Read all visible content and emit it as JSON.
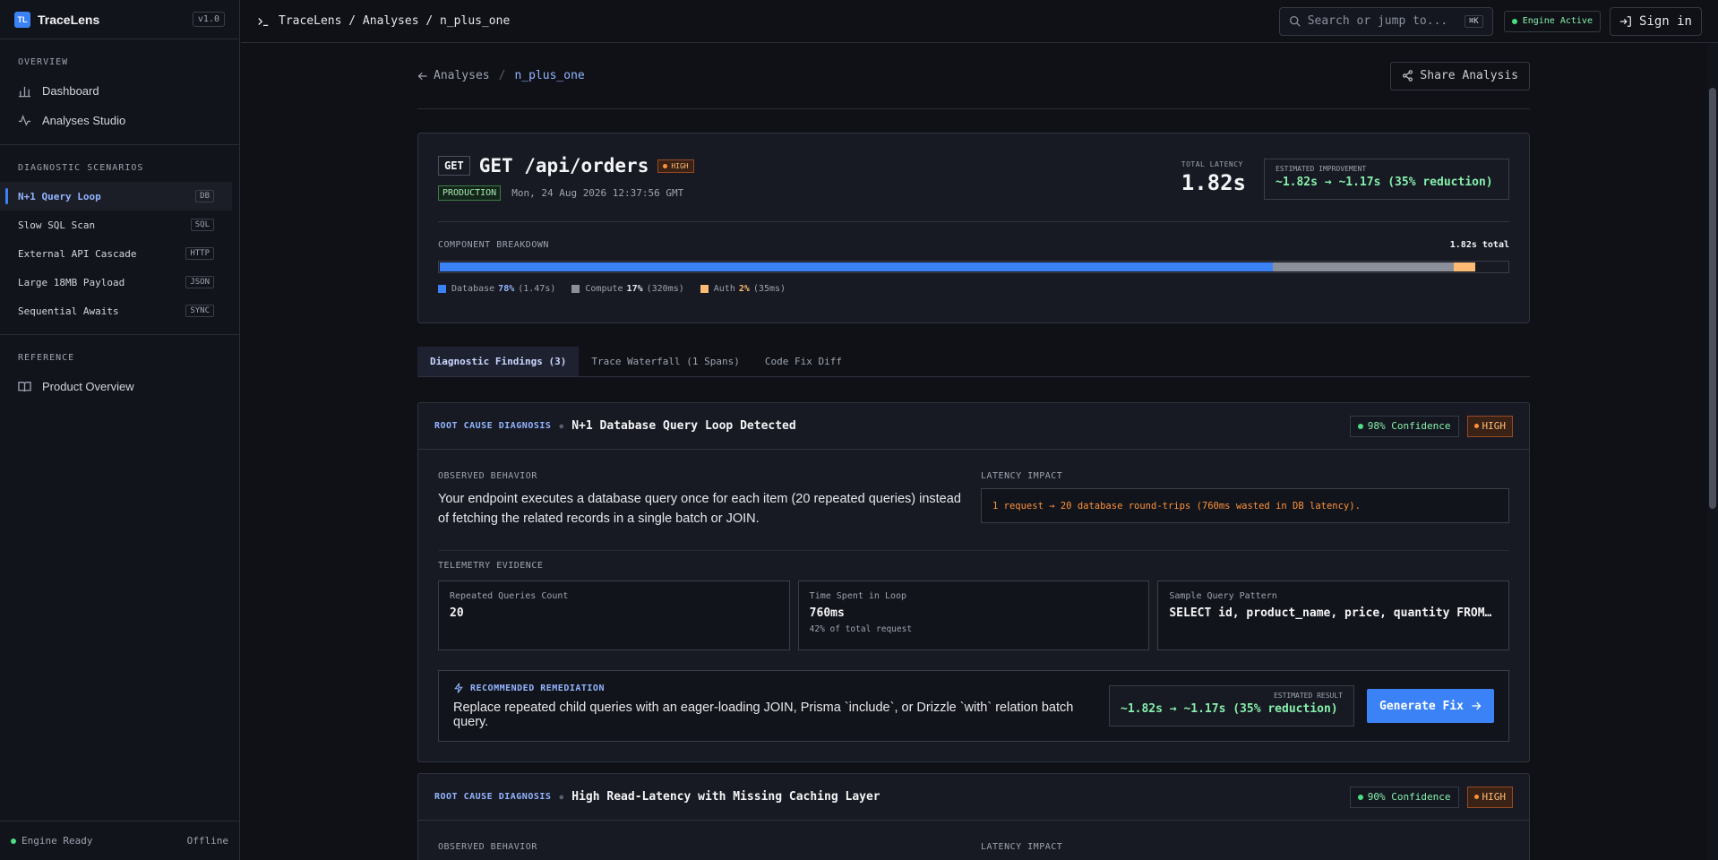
{
  "sidebar": {
    "brand_logo": "TL",
    "brand_name": "TraceLens",
    "version": "v1.0",
    "overview_header": "OVERVIEW",
    "overview_items": [
      {
        "label": "Dashboard",
        "icon": "bar-chart-icon"
      },
      {
        "label": "Analyses Studio",
        "icon": "activity-icon"
      }
    ],
    "scenarios_header": "DIAGNOSTIC SCENARIOS",
    "scenarios": [
      {
        "label": "N+1 Query Loop",
        "tag": "DB",
        "active": true
      },
      {
        "label": "Slow SQL Scan",
        "tag": "SQL"
      },
      {
        "label": "External API Cascade",
        "tag": "HTTP"
      },
      {
        "label": "Large 18MB Payload",
        "tag": "JSON"
      },
      {
        "label": "Sequential Awaits",
        "tag": "SYNC"
      }
    ],
    "reference_header": "REFERENCE",
    "reference_items": [
      {
        "label": "Product Overview",
        "icon": "book-icon"
      }
    ],
    "footer_status": "Engine Ready",
    "footer_mode": "Offline"
  },
  "topbar": {
    "breadcrumb": "TraceLens / Analyses / n_plus_one",
    "search_placeholder": "Search or jump to...",
    "search_shortcut": "⌘K",
    "engine_status": "Engine Active",
    "sign_in": "Sign in"
  },
  "page": {
    "back_label": "Analyses",
    "separator": "/",
    "current": "n_plus_one",
    "share_label": "Share Analysis"
  },
  "summary": {
    "method": "GET",
    "endpoint": "GET /api/orders",
    "severity": "HIGH",
    "environment": "PRODUCTION",
    "timestamp": "Mon, 24 Aug 2026 12:37:56 GMT",
    "latency_label": "TOTAL LATENCY",
    "latency_value": "1.82s",
    "improvement_label": "ESTIMATED IMPROVEMENT",
    "improvement_value": "~1.82s → ~1.17s (35% reduction)",
    "breakdown_label": "COMPONENT BREAKDOWN",
    "breakdown_total": "1.82s total",
    "components": [
      {
        "name": "Database",
        "pct": "78%",
        "time": "(1.47s)",
        "share": 78,
        "color": "#3b82f6"
      },
      {
        "name": "Compute",
        "pct": "17%",
        "time": "(320ms)",
        "share": 17,
        "color": "#8b8f99"
      },
      {
        "name": "Auth",
        "pct": "2%",
        "time": "(35ms)",
        "share": 2,
        "color": "#fdba74"
      }
    ]
  },
  "tabs": [
    "Diagnostic Findings (3)",
    "Trace Waterfall (1 Spans)",
    "Code Fix Diff"
  ],
  "findings": [
    {
      "kind": "ROOT CAUSE DIAGNOSIS",
      "title": "N+1 Database Query Loop Detected",
      "confidence": "98% Confidence",
      "severity": "HIGH",
      "observed_label": "OBSERVED BEHAVIOR",
      "observed_text": "Your endpoint executes a database query once for each item (20 repeated queries) instead of fetching the related records in a single batch or JOIN.",
      "impact_label": "LATENCY IMPACT",
      "impact_text": "1 request → 20 database round-trips (760ms wasted in DB latency).",
      "telemetry_label": "TELEMETRY EVIDENCE",
      "evidence": [
        {
          "title": "Repeated Queries Count",
          "value": "20",
          "sub": ""
        },
        {
          "title": "Time Spent in Loop",
          "value": "760ms",
          "sub": "42% of total request"
        },
        {
          "title": "Sample Query Pattern",
          "value": "SELECT id, product_name, price, quantity FROM order_items WHERE order_id = ?",
          "sub": ""
        }
      ],
      "remediation_label": "RECOMMENDED REMEDIATION",
      "remediation_text": "Replace repeated child queries with an eager-loading JOIN, Prisma `include`, or Drizzle `with` relation batch query.",
      "estimated_label": "ESTIMATED RESULT",
      "estimated_value": "~1.82s → ~1.17s (35% reduction)",
      "button": "Generate Fix"
    },
    {
      "kind": "ROOT CAUSE DIAGNOSIS",
      "title": "High Read-Latency with Missing Caching Layer",
      "confidence": "90% Confidence",
      "severity": "HIGH",
      "observed_label": "OBSERVED BEHAVIOR",
      "impact_label": "LATENCY IMPACT"
    }
  ]
}
